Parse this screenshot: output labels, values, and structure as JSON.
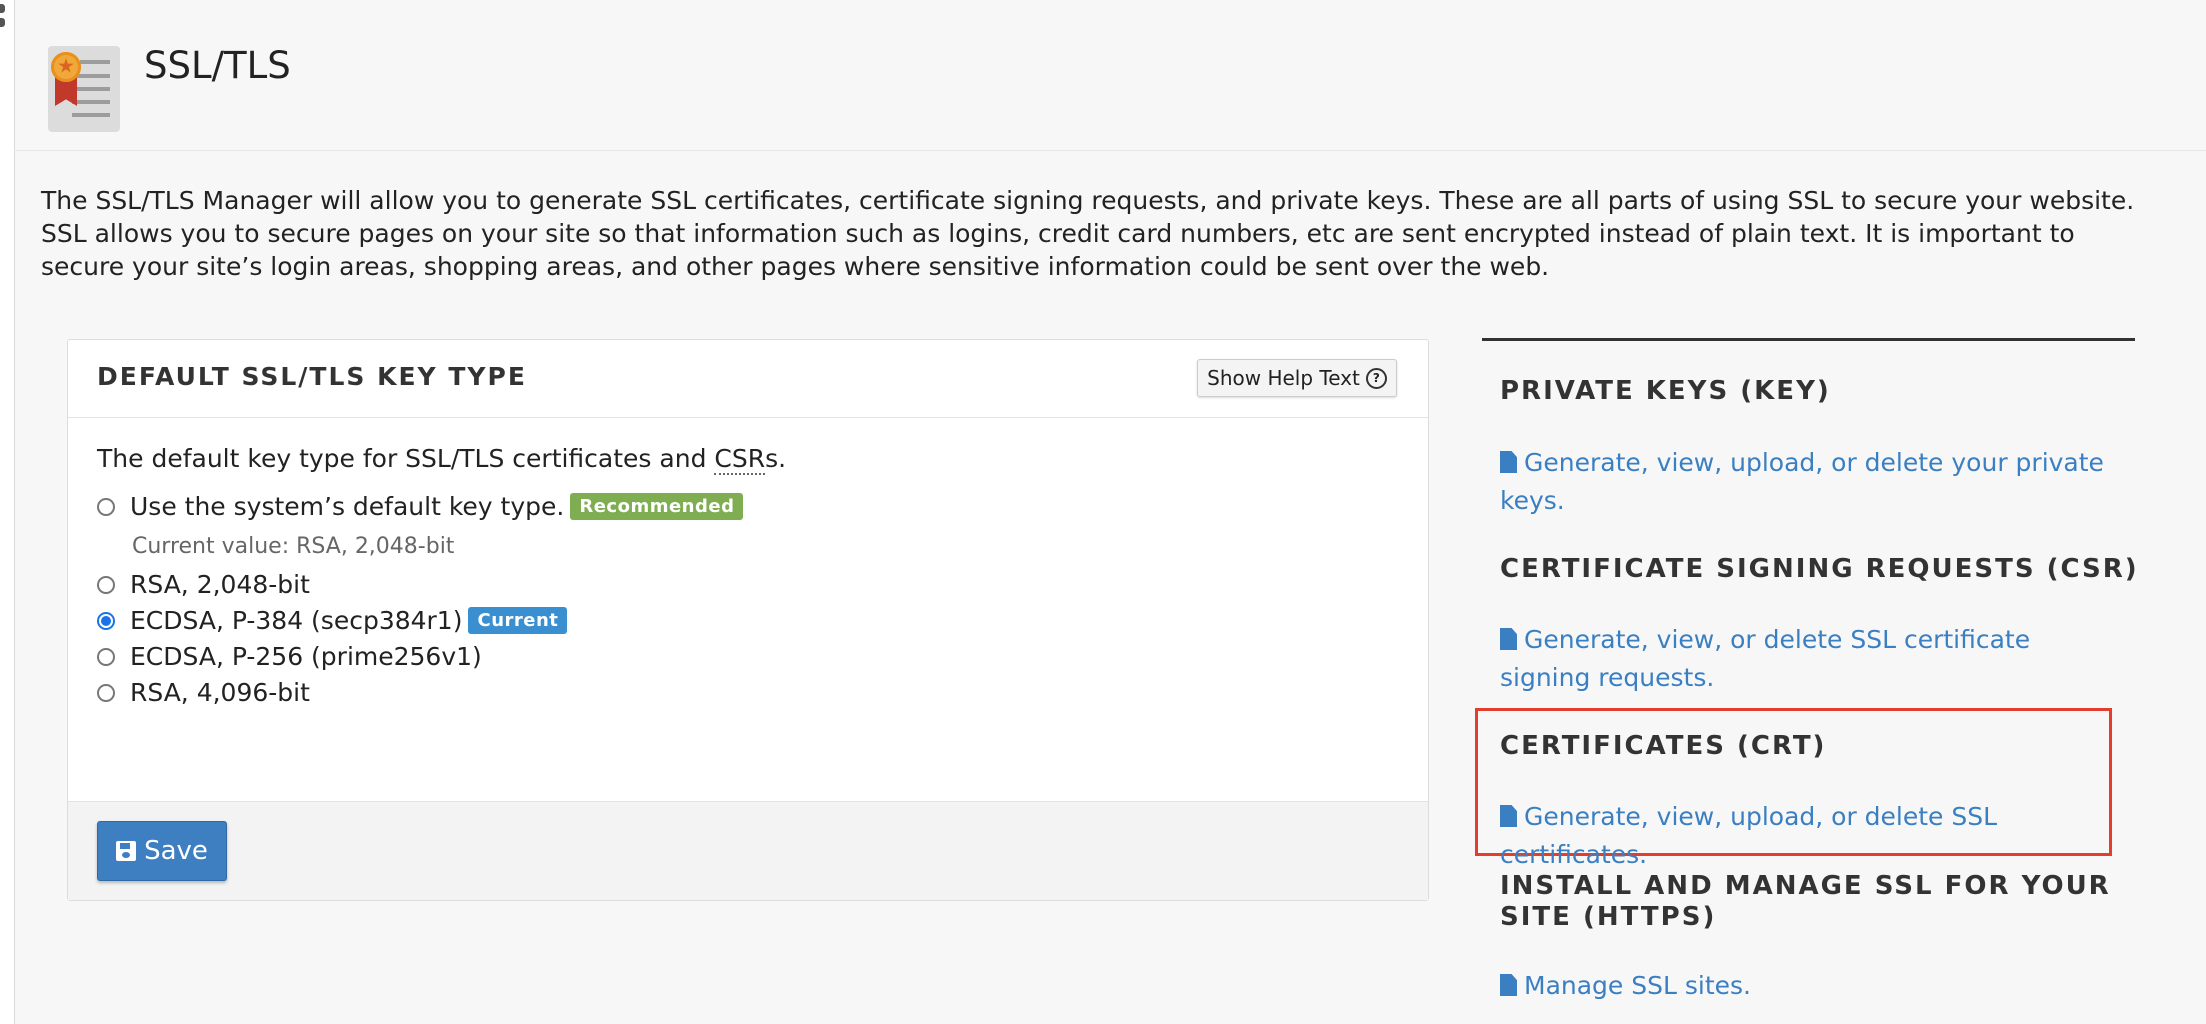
{
  "header": {
    "title": "SSL/TLS",
    "icon": "ssl-certificate-icon"
  },
  "intro": "The SSL/TLS Manager will allow you to generate SSL certificates, certificate signing requests, and private keys. These are all parts of using SSL to secure your website. SSL allows you to secure pages on your site so that information such as logins, credit card numbers, etc are sent encrypted instead of plain text. It is important to secure your site’s login areas, shopping areas, and other pages where sensitive information could be sent over the web.",
  "key_type_panel": {
    "title": "DEFAULT SSL/TLS KEY TYPE",
    "help_button": "Show Help Text",
    "help_icon": "question-circle-icon",
    "description_prefix": "The default key type for SSL/TLS certificates and ",
    "description_abbr": "CSR",
    "description_suffix": "s.",
    "options": [
      {
        "label": "Use the system’s default key type.",
        "badge": "Recommended",
        "checked": false
      },
      {
        "label": "RSA, 2,048-bit",
        "checked": false
      },
      {
        "label": "ECDSA, P-384 (secp384r1)",
        "badge": "Current",
        "checked": true
      },
      {
        "label": "ECDSA, P-256 (prime256v1)",
        "checked": false
      },
      {
        "label": "RSA, 4,096-bit",
        "checked": false
      }
    ],
    "current_value": "Current value: RSA, 2,048-bit",
    "save_button": "Save",
    "save_icon": "floppy-disk-icon",
    "colors": {
      "recommended_badge": "#7fae52",
      "current_badge": "#3a8fd1",
      "save_button": "#3e7fc1"
    }
  },
  "sections": [
    {
      "title": "PRIVATE KEYS (KEY)",
      "link": "Generate, view, upload, or delete your private keys."
    },
    {
      "title": "CERTIFICATE SIGNING REQUESTS (CSR)",
      "link": "Generate, view, or delete SSL certificate signing requests."
    },
    {
      "title": "CERTIFICATES (CRT)",
      "link": "Generate, view, upload, or delete SSL certificates.",
      "highlighted": true
    },
    {
      "title": "INSTALL AND MANAGE SSL FOR YOUR SITE (HTTPS)",
      "link": "Manage SSL sites."
    }
  ],
  "link_icon": "file-text-icon",
  "colors": {
    "link": "#3a7fc2",
    "highlight_border": "#e23d2d"
  }
}
